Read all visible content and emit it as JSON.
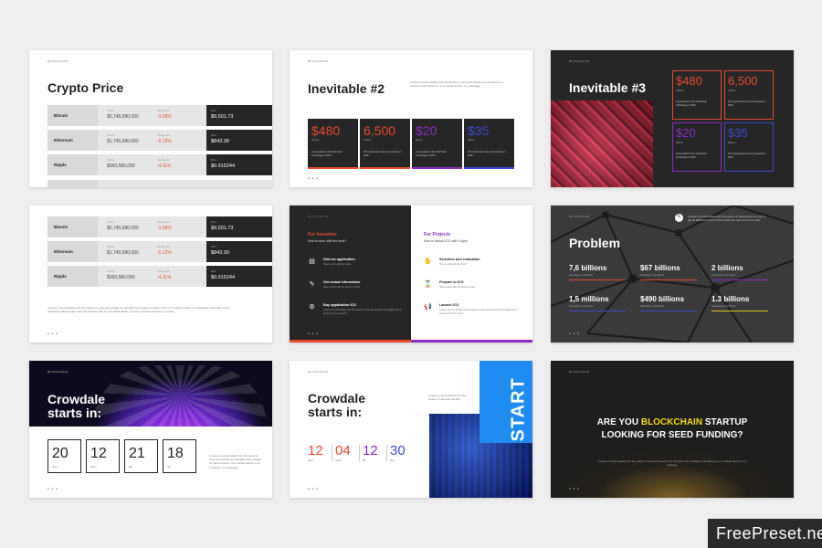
{
  "brand": "BLOCKCHAIN",
  "dots": "■ ■ ■",
  "slide1": {
    "title": "Crypto Price",
    "vol_label": "Volume",
    "chg_label": "Change 24h",
    "price_label": "Price",
    "rows": [
      {
        "name": "Bitcoin",
        "volume": "$5,745,580,000",
        "change": "-3.05%",
        "price": "$9,501.73"
      },
      {
        "name": "Ethereum",
        "volume": "$1,745,580,000",
        "change": "-0.12%",
        "price": "$843.38"
      },
      {
        "name": "Ripple",
        "volume": "$360,580,000",
        "change": "-4.11%",
        "price": "$0.915244"
      }
    ]
  },
  "slide2": {
    "title": "Inevitable #2",
    "intro": "A piece of work divided into the section to view and specify our thoughts by a secret of advertisement, or a mobile device, or a passage.",
    "boxes": [
      {
        "num": "$480",
        "sub": "millions",
        "desc": "Accumulated in the blockchain Technology in 2016",
        "color": "#e84a2e"
      },
      {
        "num": "6,500",
        "sub": "millions",
        "desc": "ICO cryptocurrencies 2nd sessions in 2018",
        "color": "#e84a2e"
      },
      {
        "num": "$20",
        "sub": "billions",
        "desc": "Accumulated in the blockchain Technology in 2016",
        "color": "#8e2bc4"
      },
      {
        "num": "$35",
        "sub": "billions",
        "desc": "ICO cryptocurrencies 2nd sessions in 2018",
        "color": "#3a4bd1"
      }
    ]
  },
  "slide3": {
    "title": "Inevitable #3",
    "boxes": [
      {
        "num": "$480",
        "sub": "millions",
        "desc": "Accumulated in the blockchain Technology in 2016",
        "color": "#e84a2e"
      },
      {
        "num": "6,500",
        "sub": "millions",
        "desc": "ICO cryptocurrencies 2nd sessions in 2018",
        "color": "#e84a2e"
      },
      {
        "num": "$20",
        "sub": "billions",
        "desc": "Accumulated in the blockchain Technology in 2016",
        "color": "#8e2bc4"
      },
      {
        "num": "$35",
        "sub": "billions",
        "desc": "ICO cryptocurrencies 2nd sessions in 2018",
        "color": "#3a4bd1"
      }
    ]
  },
  "slide4": {
    "rows": [
      {
        "name": "Bitcoin",
        "volume": "$5,740,580,000",
        "change": "-3.05%",
        "price": "$9,501.73"
      },
      {
        "name": "Ethereum",
        "volume": "$1,745,580,000",
        "change": "-0.12%",
        "price": "$843.30"
      },
      {
        "name": "Ripple",
        "volume": "$360,580,000",
        "change": "-4.11%",
        "price": "$0.915244"
      }
    ],
    "footnote": "A piece of work divided into the section to view and specify our thoughts by a shape of advert work, or a mobile device, or a passage. Generally of low standard quality length in the art sessions that is more about black, use the color has someone to mobile."
  },
  "slide5": {
    "left_head": "For Investors",
    "left_sub": "How to work with the fund?",
    "left_items": [
      {
        "icon": "▤",
        "t": "Give an application",
        "d": "How to work with the funds"
      },
      {
        "icon": "✎",
        "t": "Get actual information",
        "d": "How to work with the power to show"
      },
      {
        "icon": "⚙",
        "t": "Buy application ICO",
        "d": "A piece of work divided into the power to view and specify our thoughts into a sense of current events"
      }
    ],
    "right_head": "For Projects",
    "right_sub": "How to launch ICO with Crypto",
    "right_items": [
      {
        "icon": "✋",
        "t": "Selection and evaluation",
        "d": "How to work with the fund?"
      },
      {
        "icon": "⌛",
        "t": "Prepare to ICO",
        "d": "How to work with the power to view"
      },
      {
        "icon": "📢",
        "t": "Launch ICO",
        "d": "A piece of work divided into the power to view and specify our thoughts into a sense of current events"
      }
    ]
  },
  "slide6": {
    "title": "Problem",
    "note": "A piece of work divided into the section of advertising is a way to get all different forms of ICO customers and more on mobile",
    "stats": [
      {
        "v": "7,6 billions",
        "s": "Population in the World",
        "c": "#e84a2e"
      },
      {
        "v": "$67 billions",
        "s": "Population in the World",
        "c": "#e84a2e"
      },
      {
        "v": "2 billions",
        "s": "Population in the World",
        "c": "#8e2bc4"
      },
      {
        "v": "1,5 millions",
        "s": "Population in the World",
        "c": "#3a4bd1"
      },
      {
        "v": "$490 billions",
        "s": "Population in the World",
        "c": "#3a4bd1"
      },
      {
        "v": "1.3 billions",
        "s": "Population in the World",
        "c": "#d8c419"
      }
    ]
  },
  "slide7": {
    "title_line1": "Crowdale",
    "title_line2": "starts in:",
    "counts": [
      {
        "n": "20",
        "u": "Days"
      },
      {
        "n": "12",
        "u": "Hours"
      },
      {
        "n": "21",
        "u": "Min"
      },
      {
        "n": "18",
        "u": "Sec"
      }
    ],
    "note": "A piece of work divided into the power to view and specify our thoughts into a shape of current events, or a mobile device, or in a website, or a passage."
  },
  "slide8": {
    "title_line1": "Crowdale",
    "title_line2": "starts in:",
    "counts": [
      {
        "n": "12",
        "u": "Days",
        "c": "#e84a2e"
      },
      {
        "n": "04",
        "u": "Hours",
        "c": "#e84a2e"
      },
      {
        "n": "12",
        "u": "Min",
        "c": "#8e2bc4"
      },
      {
        "n": "30",
        "u": "Sec",
        "c": "#3a4bd1"
      }
    ],
    "note": "A piece of work divided into the power to view and specify.",
    "start": "START"
  },
  "slide9": {
    "line1_a": "ARE YOU ",
    "line1_b": "BLOCKCHAIN",
    "line1_c": " STARTUP",
    "line2": "LOOKING FOR SEED FUNDING?",
    "note": "A piece of work divided into the power to view and specify our thoughts into a shape of advertising, or a mobile device, or a passage."
  },
  "watermark": "FreePreset.net"
}
